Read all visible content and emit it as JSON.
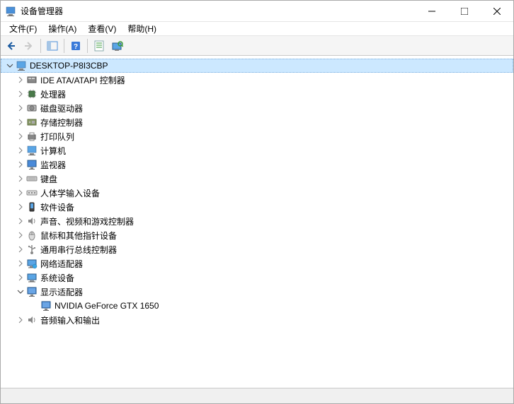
{
  "window": {
    "title": "设备管理器"
  },
  "menubar": {
    "file": "文件(F)",
    "action": "操作(A)",
    "view": "查看(V)",
    "help": "帮助(H)"
  },
  "toolbar": {
    "back": "后退",
    "forward": "前进",
    "show_hide": "显示/隐藏控制台树",
    "help": "帮助",
    "properties": "属性",
    "scan": "扫描硬件更改"
  },
  "tree": {
    "root": "DESKTOP-P8I3CBP",
    "items": [
      {
        "label": "IDE ATA/ATAPI 控制器",
        "icon": "ide"
      },
      {
        "label": "处理器",
        "icon": "cpu"
      },
      {
        "label": "磁盘驱动器",
        "icon": "disk"
      },
      {
        "label": "存储控制器",
        "icon": "storage"
      },
      {
        "label": "打印队列",
        "icon": "printer"
      },
      {
        "label": "计算机",
        "icon": "computer"
      },
      {
        "label": "监视器",
        "icon": "monitor"
      },
      {
        "label": "键盘",
        "icon": "keyboard"
      },
      {
        "label": "人体学输入设备",
        "icon": "hid"
      },
      {
        "label": "软件设备",
        "icon": "software"
      },
      {
        "label": "声音、视频和游戏控制器",
        "icon": "sound"
      },
      {
        "label": "鼠标和其他指针设备",
        "icon": "mouse"
      },
      {
        "label": "通用串行总线控制器",
        "icon": "usb"
      },
      {
        "label": "网络适配器",
        "icon": "network"
      },
      {
        "label": "系统设备",
        "icon": "system"
      },
      {
        "label": "显示适配器",
        "icon": "display",
        "expanded": true,
        "children": [
          {
            "label": "NVIDIA GeForce GTX 1650",
            "icon": "gpu"
          }
        ]
      },
      {
        "label": "音频输入和输出",
        "icon": "audio"
      }
    ]
  }
}
